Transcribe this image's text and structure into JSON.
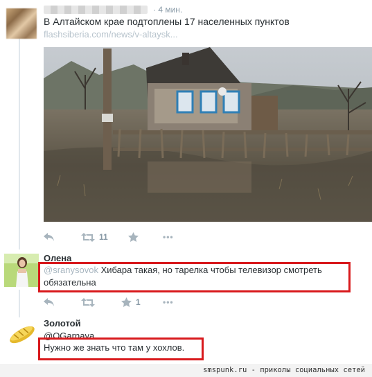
{
  "tweet": {
    "time": "· 4 мин.",
    "text": "В Алтайском крае подтоплены 17 населенных пунктов",
    "link": "flashsiberia.com/news/v-altaysk...",
    "retweets": "11",
    "favorites": "",
    "more": "•••"
  },
  "reply1": {
    "name": "Олена",
    "mention": "@sranysovok",
    "text_line1": "Хибара такая, но тарелка чтобы телевизор смотреть",
    "text_line2": "обязательна",
    "retweets": "",
    "favorites": "1"
  },
  "reply2": {
    "name": "Золотой",
    "handle": "@OGarnava",
    "text": "Нужно же знать что там у хохлов."
  },
  "footer": {
    "text": "smspunk.ru - приколы социальных сетей"
  },
  "colors": {
    "highlight": "#d8191c",
    "meta": "#8899a6",
    "link": "#b7c3cc"
  }
}
